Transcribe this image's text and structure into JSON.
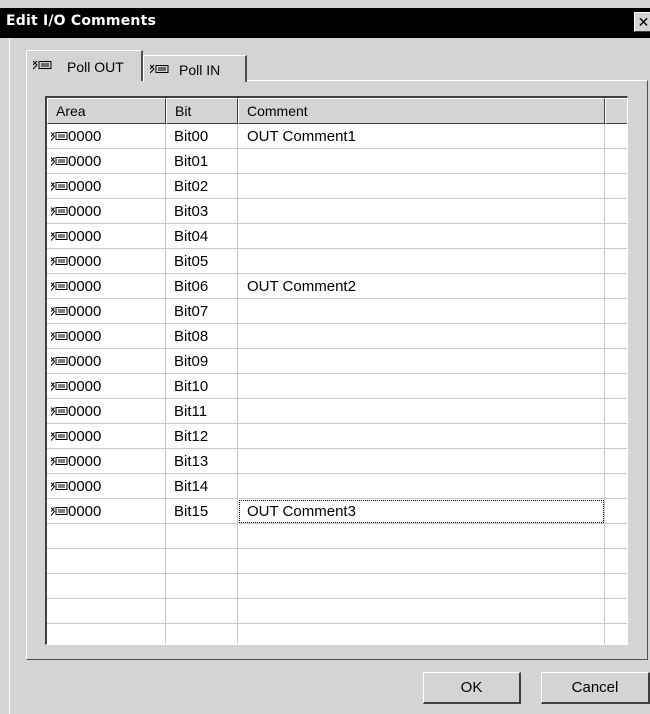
{
  "window": {
    "title": "Edit I/O Comments",
    "close_glyph": "✕"
  },
  "tabs": [
    {
      "label": "Poll OUT",
      "icon": "io-connector-icon",
      "active": true
    },
    {
      "label": "Poll IN",
      "icon": "io-connector-icon",
      "active": false
    }
  ],
  "grid": {
    "columns": [
      "Area",
      "Bit",
      "Comment"
    ],
    "rows": [
      {
        "area": "0000",
        "bit": "Bit00",
        "comment": "OUT Comment1"
      },
      {
        "area": "0000",
        "bit": "Bit01",
        "comment": ""
      },
      {
        "area": "0000",
        "bit": "Bit02",
        "comment": ""
      },
      {
        "area": "0000",
        "bit": "Bit03",
        "comment": ""
      },
      {
        "area": "0000",
        "bit": "Bit04",
        "comment": ""
      },
      {
        "area": "0000",
        "bit": "Bit05",
        "comment": ""
      },
      {
        "area": "0000",
        "bit": "Bit06",
        "comment": "OUT Comment2"
      },
      {
        "area": "0000",
        "bit": "Bit07",
        "comment": ""
      },
      {
        "area": "0000",
        "bit": "Bit08",
        "comment": ""
      },
      {
        "area": "0000",
        "bit": "Bit09",
        "comment": ""
      },
      {
        "area": "0000",
        "bit": "Bit10",
        "comment": ""
      },
      {
        "area": "0000",
        "bit": "Bit11",
        "comment": ""
      },
      {
        "area": "0000",
        "bit": "Bit12",
        "comment": ""
      },
      {
        "area": "0000",
        "bit": "Bit13",
        "comment": ""
      },
      {
        "area": "0000",
        "bit": "Bit14",
        "comment": ""
      },
      {
        "area": "0000",
        "bit": "Bit15",
        "comment": "OUT Comment3"
      }
    ],
    "empty_rows": 5
  },
  "buttons": {
    "ok": "OK",
    "cancel": "Cancel"
  },
  "colors": {
    "dialog_bg": "#d4d4d4",
    "titlebar_bg": "#000000",
    "grid_bg": "#ffffff",
    "grid_line": "#c8c8c8"
  }
}
